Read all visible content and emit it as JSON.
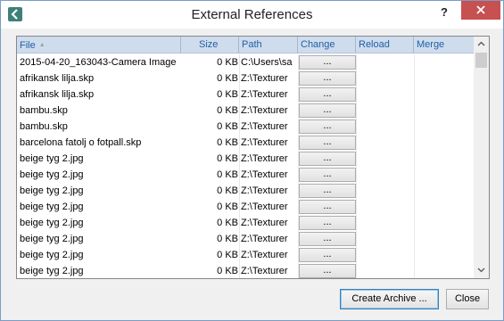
{
  "window": {
    "title": "External References",
    "help_label": "?"
  },
  "columns": {
    "file": "File",
    "size": "Size",
    "path": "Path",
    "change": "Change",
    "reload": "Reload",
    "merge": "Merge"
  },
  "rows": [
    {
      "file": "2015-04-20_163043-Camera Image",
      "size": "0 KB",
      "path": "C:\\Users\\sa",
      "change": "..."
    },
    {
      "file": "afrikansk lilja.skp",
      "size": "0 KB",
      "path": "Z:\\Texturer",
      "change": "..."
    },
    {
      "file": "afrikansk lilja.skp",
      "size": "0 KB",
      "path": "Z:\\Texturer",
      "change": "..."
    },
    {
      "file": "bambu.skp",
      "size": "0 KB",
      "path": "Z:\\Texturer",
      "change": "..."
    },
    {
      "file": "bambu.skp",
      "size": "0 KB",
      "path": "Z:\\Texturer",
      "change": "..."
    },
    {
      "file": "barcelona fatolj o fotpall.skp",
      "size": "0 KB",
      "path": "Z:\\Texturer",
      "change": "..."
    },
    {
      "file": "beige tyg 2.jpg",
      "size": "0 KB",
      "path": "Z:\\Texturer",
      "change": "..."
    },
    {
      "file": "beige tyg 2.jpg",
      "size": "0 KB",
      "path": "Z:\\Texturer",
      "change": "..."
    },
    {
      "file": "beige tyg 2.jpg",
      "size": "0 KB",
      "path": "Z:\\Texturer",
      "change": "..."
    },
    {
      "file": "beige tyg 2.jpg",
      "size": "0 KB",
      "path": "Z:\\Texturer",
      "change": "..."
    },
    {
      "file": "beige tyg 2.jpg",
      "size": "0 KB",
      "path": "Z:\\Texturer",
      "change": "..."
    },
    {
      "file": "beige tyg 2.jpg",
      "size": "0 KB",
      "path": "Z:\\Texturer",
      "change": "..."
    },
    {
      "file": "beige tyg 2.jpg",
      "size": "0 KB",
      "path": "Z:\\Texturer",
      "change": "..."
    },
    {
      "file": "beige tyg 2.jpg",
      "size": "0 KB",
      "path": "Z:\\Texturer",
      "change": "..."
    }
  ],
  "buttons": {
    "create_archive": "Create Archive ...",
    "close": "Close"
  },
  "icons": {
    "app": "back-arrow-icon",
    "close": "close-icon",
    "scroll_up": "chevron-up-icon",
    "scroll_down": "chevron-down-icon",
    "sort": "sort-ascending-icon"
  }
}
